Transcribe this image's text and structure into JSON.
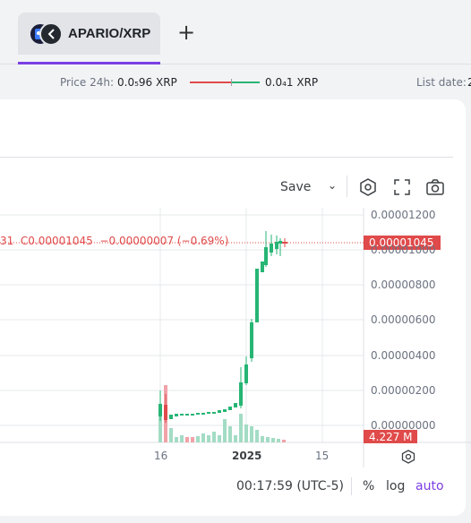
{
  "tab": {
    "label": "APARIO/XRP",
    "add_label": "+"
  },
  "info": {
    "price24h_label": "Price 24h:",
    "price24h_low": "0.0₅96 XRP",
    "price24h_high": "0.0₄1 XRP",
    "list_date_label": "List date:",
    "list_date_value": "2"
  },
  "toolbar": {
    "save_label": "Save",
    "save_caret": "⌄"
  },
  "legend": {
    "text": "31  C0.00001045  −0.00000007 (−0.69%)"
  },
  "price_axis": {
    "ticks": [
      "0.00001200",
      "0.00001000",
      "0.00000800",
      "0.00000600",
      "0.00000400",
      "0.00000200",
      "0.00000000"
    ],
    "last_price": "0.00001045",
    "volume_label": "4.227 M"
  },
  "time_axis": {
    "ticks": [
      "16",
      "2025",
      "15"
    ]
  },
  "footer": {
    "time": "00:17:59 (UTC-5)",
    "percent": "%",
    "log": "log",
    "auto": "auto"
  },
  "colors": {
    "up": "#26b574",
    "down": "#e04a4a",
    "accent": "#7b3fe4",
    "link": "#7b3fe4"
  }
}
